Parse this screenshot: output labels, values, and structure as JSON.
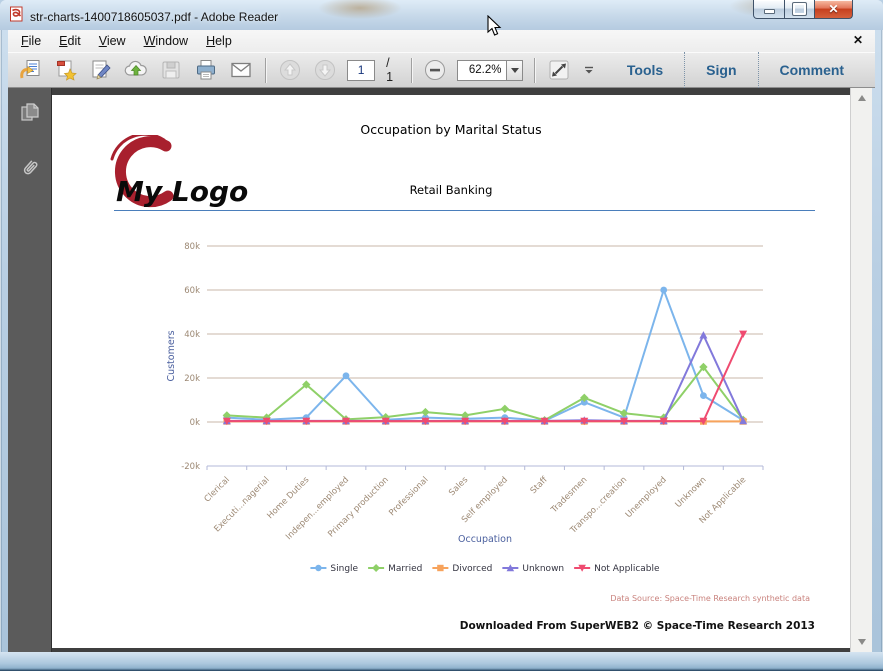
{
  "window": {
    "title": "str-charts-1400718605037.pdf - Adobe Reader"
  },
  "menu": {
    "items": [
      "File",
      "Edit",
      "View",
      "Window",
      "Help"
    ]
  },
  "toolbar": {
    "page_current": "1",
    "page_total": "/ 1",
    "zoom_level": "62.2%",
    "tools_label": "Tools",
    "sign_label": "Sign",
    "comment_label": "Comment"
  },
  "page": {
    "title": "Occupation by Marital Status",
    "subtitle": "Retail Banking",
    "logo_text": "My Logo",
    "data_source": "Data Source: Space-Time Research synthetic data",
    "footer": "Downloaded From SuperWEB2 © Space-Time Research 2013"
  },
  "chart_data": {
    "type": "line",
    "title": "",
    "xlabel": "Occupation",
    "ylabel": "Customers",
    "ylim": [
      -20000,
      80000
    ],
    "yticks": [
      -20000,
      0,
      20000,
      40000,
      60000,
      80000
    ],
    "ytick_labels": [
      "-20k",
      "0k",
      "20k",
      "40k",
      "60k",
      "80k"
    ],
    "grid": true,
    "legend_position": "bottom",
    "grid_color": "#c9b7a8",
    "axis_color": "#b3b9d8",
    "tick_label_color": "#9c8873",
    "axis_title_color": "#4a5f9e",
    "legend_text_color": "#333340",
    "categories": [
      "Clerical",
      "Executi...nagerial",
      "Home Duties",
      "Indepen...employed",
      "Primary production",
      "Professional",
      "Sales",
      "Self employed",
      "Staff",
      "Tradesmen",
      "Transpo...creation",
      "Unemployed",
      "Unknown",
      "Not Applicable"
    ],
    "series": [
      {
        "name": "Single",
        "color": "#7cb5ec",
        "marker": "circle",
        "values": [
          2000,
          1000,
          2000,
          21000,
          1000,
          2000,
          1500,
          2000,
          500,
          9000,
          2000,
          60000,
          12000,
          800
        ]
      },
      {
        "name": "Married",
        "color": "#8fd068",
        "marker": "diamond",
        "values": [
          3000,
          2000,
          17000,
          1200,
          2200,
          4500,
          3000,
          6000,
          800,
          11000,
          4000,
          2000,
          25000,
          1000
        ]
      },
      {
        "name": "Divorced",
        "color": "#f7a35c",
        "marker": "square",
        "values": [
          300,
          300,
          300,
          300,
          300,
          300,
          300,
          300,
          300,
          300,
          300,
          300,
          300,
          300
        ]
      },
      {
        "name": "Unknown",
        "color": "#8279db",
        "marker": "triangle",
        "values": [
          500,
          500,
          500,
          500,
          500,
          500,
          500,
          500,
          500,
          800,
          500,
          500,
          39500,
          500
        ]
      },
      {
        "name": "Not Applicable",
        "color": "#ef4b70",
        "marker": "triangle-down",
        "values": [
          400,
          400,
          400,
          400,
          400,
          400,
          400,
          400,
          400,
          400,
          400,
          400,
          400,
          40000
        ]
      }
    ]
  }
}
